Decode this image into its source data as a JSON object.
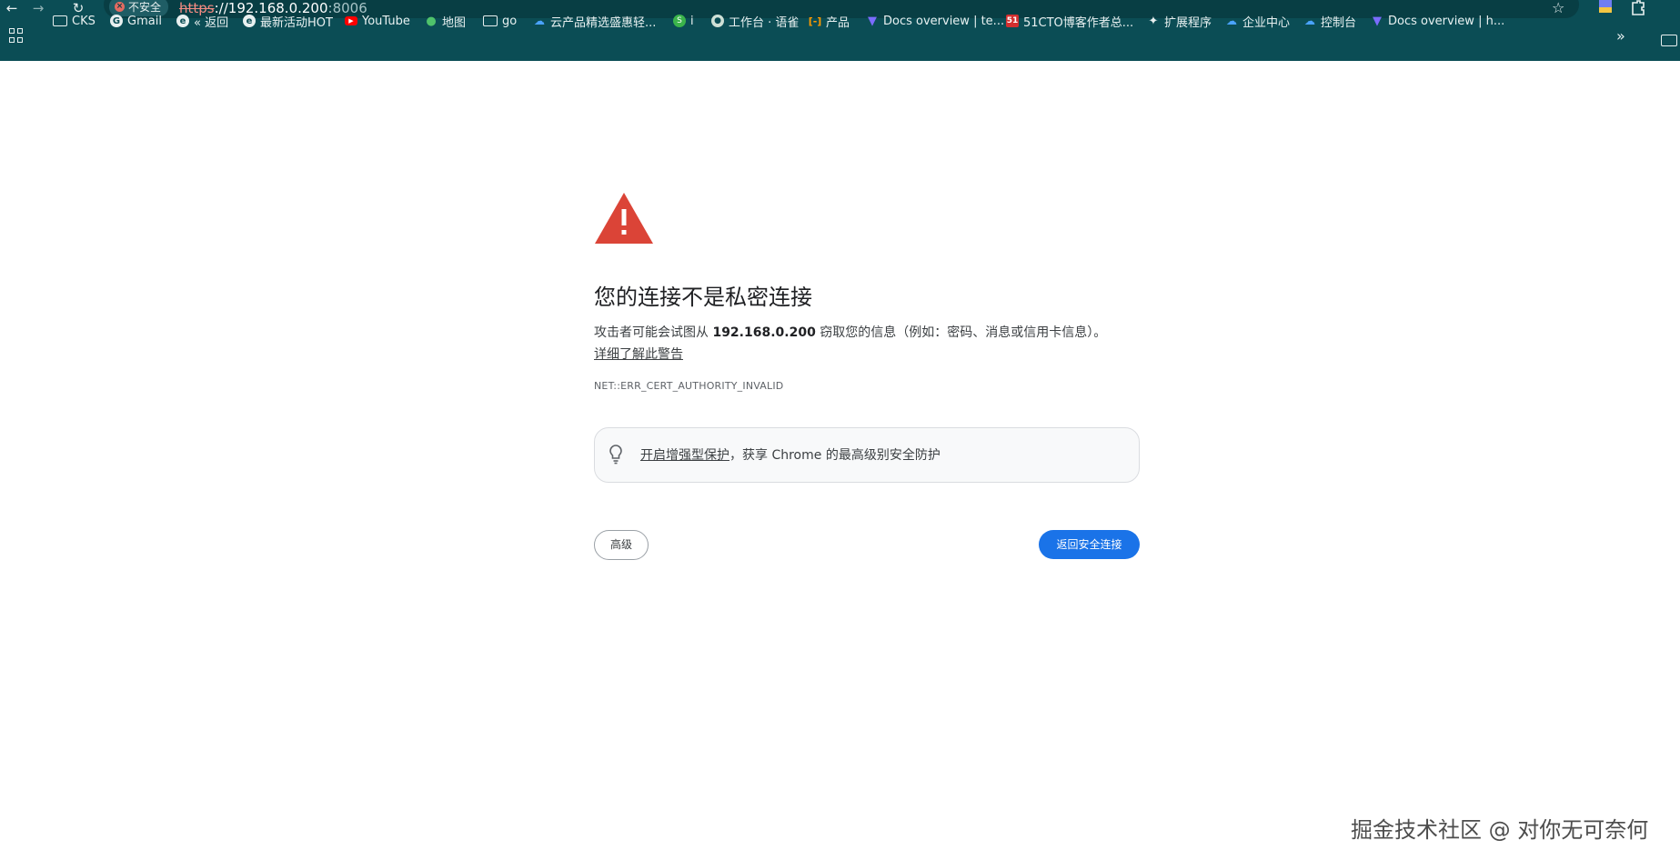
{
  "browser": {
    "security_chip_label": "不安全",
    "url_scheme": "https",
    "url_host": "://192.168.0.200",
    "url_port": ":8006"
  },
  "bookmarks": [
    {
      "label": "CKS",
      "icon": "folder-icon"
    },
    {
      "label": "Gmail",
      "icon": "google-icon"
    },
    {
      "label": "« 返回",
      "icon": "globe-icon"
    },
    {
      "label": "最新活动HOT",
      "icon": "globe-icon"
    },
    {
      "label": "YouTube",
      "icon": "youtube-icon"
    },
    {
      "label": "地图",
      "icon": "maps-icon"
    },
    {
      "label": "go",
      "icon": "folder-icon"
    },
    {
      "label": "云产品精选盛惠轻...",
      "icon": "cloud-icon"
    },
    {
      "label": "i",
      "icon": "green-circle-icon"
    },
    {
      "label": "工作台 · 语雀",
      "icon": "yuque-icon"
    },
    {
      "label": "产品",
      "icon": "aliyun-icon"
    },
    {
      "label": "Docs overview | te...",
      "icon": "terraform-icon"
    },
    {
      "label": "51CTO博客作者总...",
      "icon": "51cto-icon"
    },
    {
      "label": "扩展程序",
      "icon": "puzzle-icon"
    },
    {
      "label": "企业中心",
      "icon": "cloud-icon"
    },
    {
      "label": "控制台",
      "icon": "cloud-icon"
    },
    {
      "label": "Docs overview | h...",
      "icon": "terraform-icon"
    }
  ],
  "page": {
    "heading": "您的连接不是私密连接",
    "explanation_prefix": "攻击者可能会试图从 ",
    "explanation_host": "192.168.0.200",
    "explanation_suffix": " 窃取您的信息（例如：密码、消息或信用卡信息）。",
    "learn_more": "详细了解此警告",
    "error_code": "NET::ERR_CERT_AUTHORITY_INVALID",
    "enhanced_link": "开启增强型保护",
    "enhanced_rest": "，获享 Chrome 的最高级别安全防护",
    "advanced_label": "高级",
    "back_label": "返回安全连接"
  },
  "watermark": "掘金技术社区 @ 对你无可奈何",
  "colors": {
    "chrome_bg": "#0b4d55",
    "warning_red": "#db4437",
    "primary_blue": "#1a73e8"
  }
}
